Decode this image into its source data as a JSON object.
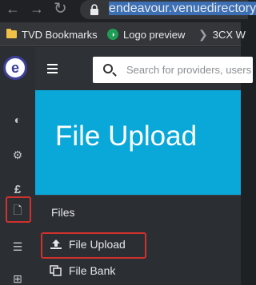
{
  "browser": {
    "url": "endeavour.venuedirectory."
  },
  "bookmarks": [
    {
      "label": "TVD Bookmarks",
      "icon": "folder-icon"
    },
    {
      "label": "Logo preview",
      "icon": "logo-icon"
    },
    {
      "label": "3CX W",
      "icon": "chevron-icon"
    }
  ],
  "app": {
    "logo_letter": "e",
    "search_placeholder": "Search for providers, users"
  },
  "sidebar": {
    "items": [
      {
        "name": "dashboard-icon",
        "glyph": "◐"
      },
      {
        "name": "settings-icon",
        "glyph": "⚙"
      },
      {
        "name": "finance-icon",
        "glyph": "£"
      },
      {
        "name": "files-icon",
        "glyph": "🗋"
      },
      {
        "name": "list-icon",
        "glyph": "☰"
      },
      {
        "name": "grid-icon",
        "glyph": "⊞"
      }
    ]
  },
  "page": {
    "title": "File Upload"
  },
  "flyout": {
    "heading": "Files",
    "items": [
      {
        "label": "File Upload",
        "icon": "upload-icon"
      },
      {
        "label": "File Bank",
        "icon": "copy-icon"
      }
    ]
  },
  "colors": {
    "accent": "#0aa7d9",
    "highlight": "#d0312d",
    "sidebar": "#2b2e33"
  }
}
